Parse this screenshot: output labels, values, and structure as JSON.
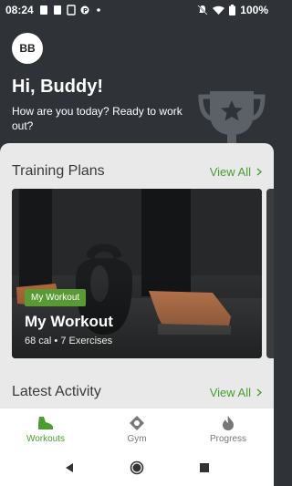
{
  "status_bar": {
    "time": "08:24",
    "battery": "100%"
  },
  "header": {
    "avatar_initials": "BB",
    "greeting": "Hi, Buddy!",
    "subtitle": "How are you today? Ready to work out?"
  },
  "training_plans": {
    "title": "Training Plans",
    "view_all": "View All",
    "card": {
      "badge": "My Workout",
      "title": "My Workout",
      "meta": "68 cal • 7 Exercises"
    }
  },
  "latest_activity": {
    "title": "Latest Activity",
    "view_all": "View All"
  },
  "bottom_nav": {
    "items": [
      {
        "label": "Workouts",
        "icon": "sneaker-icon",
        "active": true
      },
      {
        "label": "Gym",
        "icon": "location-pin-icon",
        "active": false
      },
      {
        "label": "Progress",
        "icon": "flame-icon",
        "active": false
      }
    ]
  },
  "colors": {
    "accent": "#4a9e2f",
    "header_bg": "#2f3338",
    "sheet_bg": "#e9e9e9"
  }
}
